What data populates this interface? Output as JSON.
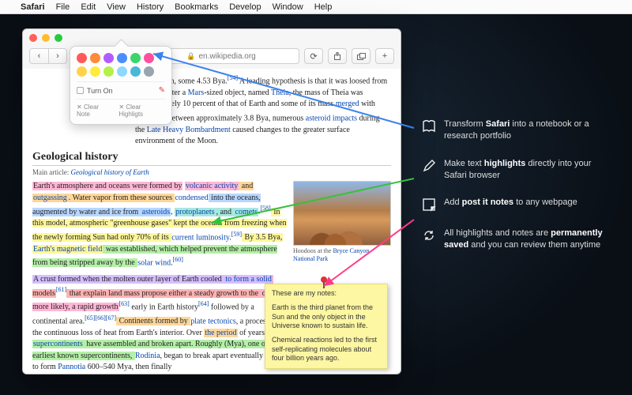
{
  "menubar": {
    "app": "Safari",
    "items": [
      "File",
      "Edit",
      "View",
      "History",
      "Bookmarks",
      "Develop",
      "Window",
      "Help"
    ]
  },
  "toolbar": {
    "url": "en.wikipedia.org"
  },
  "popover": {
    "colors": [
      "#ff5a5a",
      "#ff8a3a",
      "#b25cff",
      "#4a8dff",
      "#3ad66b",
      "#ff4fa0",
      "#ffd24a",
      "#ffeb3b",
      "#b4f04a",
      "#8dd8ff",
      "#4ab7d6",
      "#9aa4ac"
    ],
    "turn_on": "Turn On",
    "clear_note": "Clear Note",
    "clear_hl": "Clear Highligts"
  },
  "article": {
    "lead": {
      "t1": "of the Moon, some 4.53 Bya.",
      "ref1": "[54]",
      "t2": " A leading hypothesis is that it was loosed from the Earth after a ",
      "link_mars": "Mars",
      "t3": "-sized object, named ",
      "link_theia": "Theia",
      "t4": ", the mass of Theia was approximately 10 percent of that of Earth and some of its mass ",
      "link_merged": "merged",
      "t5": " with Earth.",
      "ref2": "[57]",
      "t6": " Between approximately 3.8 Bya, numerous ",
      "link_ai": "asteroid impacts",
      "t7": " during the ",
      "link_lhb": "Late Heavy Bombardment",
      "t8": " caused changes to the greater surface environment of the Moon."
    },
    "section": "Geological history",
    "mainart_lead": "Main article: ",
    "mainart_link": "Geological history of Earth",
    "p1": {
      "s1": "Earth's atmosphere and oceans were formed by",
      "link_va": "volcanic activity",
      "s_and": " and ",
      "link_og": "outgassing",
      "s2": ". Water vapor from these sources ",
      "link_cond": "condensed",
      "s3": " into the oceans, augmented by water and ice from ",
      "link_ast": "asteroids",
      "link_pp": "protoplanets",
      "s_comma": ", ",
      "s_and2": ", and ",
      "link_com": "comets",
      "s_dot": ".",
      "ref58": "[58]",
      "s4": " In this model, atmospheric \"greenhouse gases\" kept the oceans from freezing when the newly forming Sun had only 70% of its ",
      "link_lum": "current luminosity",
      "s5": ".",
      "ref59": "[59]",
      "s6": " By 3.5 Bya, ",
      "link_emf": "Earth's magnetic field",
      "s7": " was established, which helped prevent the atmosphere from being stripped away by the ",
      "link_sw": "solar wind",
      "s8": ".",
      "ref60": "[60]"
    },
    "p2": {
      "s1": "A crust formed when the molten outer layer of Earth cooled ",
      "link_form": "to form a solid",
      "s2": " models",
      "ref61": "[61]",
      "s3": " that explain land mass propose either a steady growth to the ",
      "s4": "or, more likely, a rapid growth",
      "ref63": "[63]",
      "s5": " early in Earth history",
      "ref64": "[64]",
      "s6": " followed by a continental area.",
      "refm": "[65][66][67]",
      "s7": " Continents formed by ",
      "link_pt": "plate tectonics",
      "s8": ", a process by the continuous loss of heat from Earth's interior. Over ",
      "link_period": "the period",
      "s9": " of years, the ",
      "link_sc": "supercontinents",
      "s10": " have assembled and broken apart. Roughly (Mya), one of the earliest known supercontinents, ",
      "link_rod": "Rodinia",
      "s11": ", began to break apart eventually then to form ",
      "link_pan": "Pannotia",
      "s12": " 600–540 Mya, then finally"
    },
    "caption_pre": "Hoodoos at the ",
    "caption_link1": "Bryce Canyon National Park"
  },
  "sticky": {
    "title": "These are my notes:",
    "p1": "Earth is the third planet from the Sun and the only object in the Universe known to sustain life.",
    "p2": "Chemical reactions led to the first self-replicating molecules about four billion years ago."
  },
  "promo": {
    "i1a": "Transform ",
    "i1b": "Safari",
    "i1c": " into a notebook or a research portfolio",
    "i2a": "Make text ",
    "i2b": "highlights",
    "i2c": " directly into your Safari browser",
    "i3a": "Add ",
    "i3b": "post it notes",
    "i3c": " to any webpage",
    "i4a": "All highlights and notes are ",
    "i4b": "permanently saved",
    "i4c": " and you can review them anytime"
  }
}
